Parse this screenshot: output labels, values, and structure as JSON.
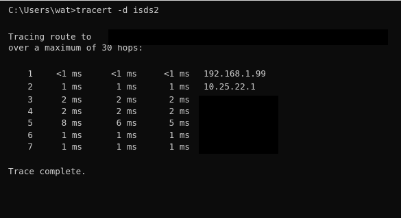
{
  "console": {
    "prompt_line": "C:\\Users\\wat>tracert -d isds2",
    "tracing_text": "Tracing route to",
    "max_hops_text": "over a maximum of 30 hops:",
    "hops": [
      {
        "num": "1",
        "t1": "<1 ms",
        "t2": "<1 ms",
        "t3": "<1 ms",
        "host": "192.168.1.99"
      },
      {
        "num": "2",
        "t1": "1 ms",
        "t2": "1 ms",
        "t3": "1 ms",
        "host": "10.25.22.1"
      },
      {
        "num": "3",
        "t1": "2 ms",
        "t2": "2 ms",
        "t3": "2 ms",
        "host": ""
      },
      {
        "num": "4",
        "t1": "2 ms",
        "t2": "2 ms",
        "t3": "2 ms",
        "host": ""
      },
      {
        "num": "5",
        "t1": "8 ms",
        "t2": "6 ms",
        "t3": "5 ms",
        "host": ""
      },
      {
        "num": "6",
        "t1": "1 ms",
        "t2": "1 ms",
        "t3": "1 ms",
        "host": ""
      },
      {
        "num": "7",
        "t1": "1 ms",
        "t2": "1 ms",
        "t3": "1 ms",
        "host": ""
      }
    ],
    "complete_text": "Trace complete."
  },
  "colors": {
    "background": "#0c0c0c",
    "text": "#cccccc",
    "redaction": "#000000"
  }
}
